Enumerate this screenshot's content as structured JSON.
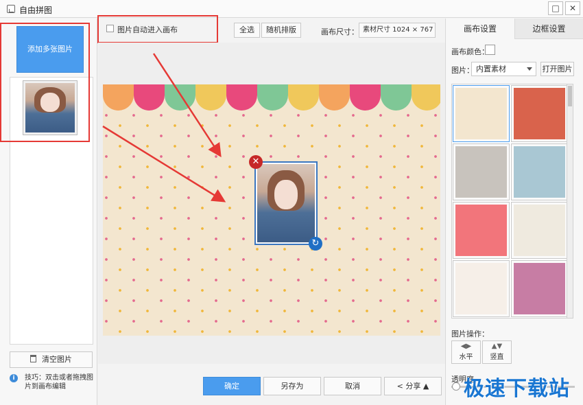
{
  "window": {
    "title": "自由拼图",
    "maximize_glyph": "□",
    "close_glyph": "✕"
  },
  "left": {
    "add_button": "添加多张图片",
    "clear_button": "清空图片",
    "tip": "技巧：双击或者拖拽图片到画布编辑"
  },
  "toolbar": {
    "auto_enter_label": "图片自动进入画布",
    "select_all": "全选",
    "random_arrange": "随机排版",
    "canvas_size_label": "画布尺寸：",
    "canvas_size_value": "素材尺寸 1024 × 767"
  },
  "canvas": {
    "scallop_colors": [
      "#f4a45e",
      "#e8497c",
      "#7fc796",
      "#f0c85b",
      "#e8497c",
      "#7fc796",
      "#f0c85b",
      "#f4a45e",
      "#e8497c",
      "#7fc796",
      "#f0c85b"
    ],
    "background": "#f3e6cf"
  },
  "bottom": {
    "confirm": "确定",
    "save_as": "另存为",
    "cancel": "取消",
    "share": "分享"
  },
  "right": {
    "tabs": [
      "画布设置",
      "边框设置"
    ],
    "canvas_color_label": "画布颜色：",
    "image_label": "图片：",
    "image_source": "内置素材",
    "open_image": "打开图片",
    "templates": [
      {
        "color": "#f3e6cf"
      },
      {
        "color": "#d9634c"
      },
      {
        "color": "#c8c3bd"
      },
      {
        "color": "#a9c7d3"
      },
      {
        "color": "#f2757b"
      },
      {
        "color": "#efeadf"
      },
      {
        "color": "#f6efe8"
      },
      {
        "color": "#c77da4"
      }
    ],
    "operations_label": "图片操作：",
    "op_horizontal": "水平",
    "op_vertical": "竖直",
    "opacity_label": "透明度"
  },
  "watermark": "极速下载站"
}
